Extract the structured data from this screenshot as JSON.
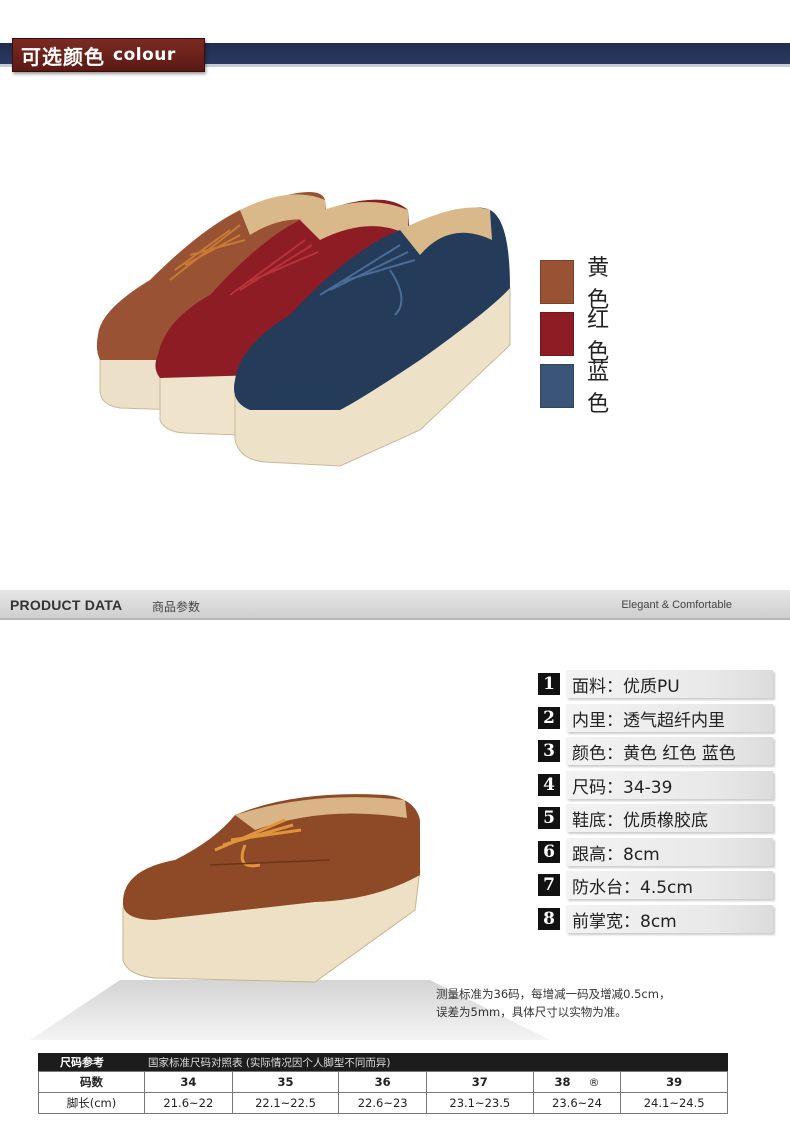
{
  "colour_header": {
    "zh": "可选颜色",
    "en": "colour"
  },
  "swatches": [
    {
      "label": "黄色",
      "color": "#9a5234"
    },
    {
      "label": "红色",
      "color": "#8d1c24"
    },
    {
      "label": "蓝色",
      "color": "#3a5578"
    }
  ],
  "product_data_bar": {
    "title": "PRODUCT DATA",
    "zh": "商品参数",
    "right": "Elegant & Comfortable"
  },
  "params": [
    {
      "num": "1",
      "text": "面料：优质PU"
    },
    {
      "num": "2",
      "text": "内里：透气超纤内里"
    },
    {
      "num": "3",
      "text": "颜色：黄色 红色 蓝色"
    },
    {
      "num": "4",
      "text": "尺码：34-39"
    },
    {
      "num": "5",
      "text": "鞋底：优质橡胶底"
    },
    {
      "num": "6",
      "text": "跟高：8cm"
    },
    {
      "num": "7",
      "text": "防水台：4.5cm"
    },
    {
      "num": "8",
      "text": "前掌宽：8cm"
    }
  ],
  "note": {
    "line1": "测量标准为36码，每增减一码及增减0.5cm，",
    "line2": "误差为5mm，具体尺寸以实物为准。"
  },
  "size_table": {
    "title": "尺码参考",
    "subtitle": "国家标准尺码对照表 (实际情况因个人脚型不同而异)",
    "header_label": "码数",
    "row_label": "脚长(cm)",
    "sizes": [
      "34",
      "35",
      "36",
      "37",
      "38",
      "39"
    ],
    "lengths": [
      "21.6~22",
      "22.1~22.5",
      "22.6~23",
      "23.1~23.5",
      "23.6~24",
      "24.1~24.5"
    ],
    "reg_mark": "®"
  }
}
